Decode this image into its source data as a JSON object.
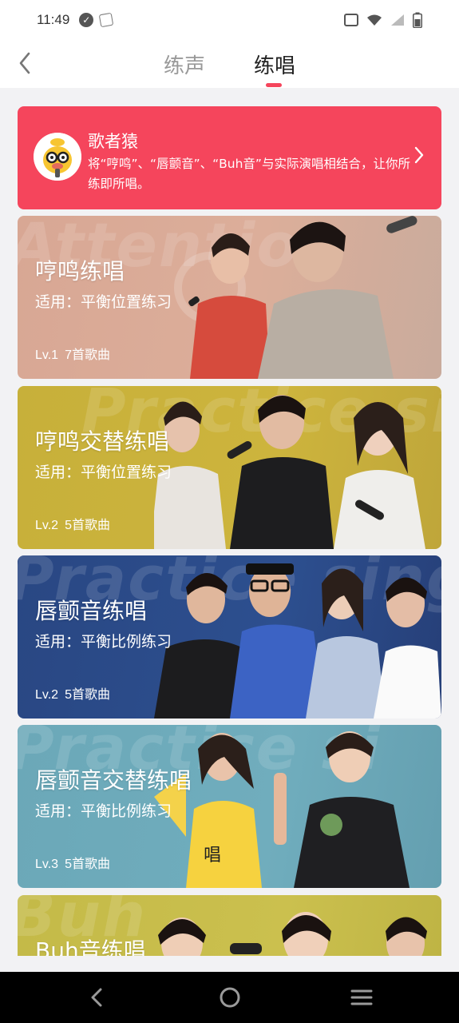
{
  "status_bar": {
    "time": "11:49",
    "left_icons": [
      "check-circle-icon",
      "notification-icon"
    ],
    "right_icons": [
      "vibrate-icon",
      "wifi-icon",
      "signal-icon",
      "battery-icon"
    ]
  },
  "header": {
    "back_icon": "chevron-left-icon",
    "tabs": [
      {
        "label": "练声",
        "active": false
      },
      {
        "label": "练唱",
        "active": true
      }
    ],
    "accent": "#f5455c"
  },
  "promo": {
    "title": "歌者猿",
    "description": "将“哼鸣”、“唇颤音”、“Buh音”与实际演唱相结合，让你所练即所唱。",
    "avatar_icon": "monkey-mascot-icon",
    "chevron_icon": "chevron-right-icon",
    "background": "#f5455c"
  },
  "cards": [
    {
      "title": "哼鸣练唱",
      "subtitle": "适用：平衡位置练习",
      "level": "Lv.1",
      "songs": "7首歌曲",
      "color": "#d9a390",
      "watermark": "Attention"
    },
    {
      "title": "哼鸣交替练唱",
      "subtitle": "适用：平衡位置练习",
      "level": "Lv.2",
      "songs": "5首歌曲",
      "color": "#c9b23a",
      "watermark": "Practice sing"
    },
    {
      "title": "唇颤音练唱",
      "subtitle": "适用：平衡比例练习",
      "level": "Lv.2",
      "songs": "5首歌曲",
      "color": "#2b4a86",
      "watermark": "Practice sing"
    },
    {
      "title": "唇颤音交替练唱",
      "subtitle": "适用：平衡比例练习",
      "level": "Lv.3",
      "songs": "5首歌曲",
      "color": "#6aa7b8",
      "watermark": "Practice si"
    },
    {
      "title": "Buh音练唱",
      "subtitle": "",
      "level": "",
      "songs": "",
      "color": "#c3b94a",
      "watermark": "Buh"
    }
  ],
  "navbar": {
    "icons": [
      "nav-back-icon",
      "nav-home-icon",
      "nav-menu-icon"
    ]
  }
}
